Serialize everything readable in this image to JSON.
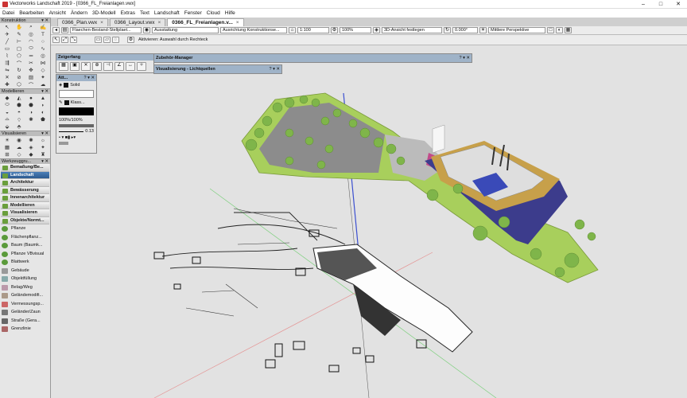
{
  "window": {
    "title": "Vectorworks Landschaft 2019 - [0366_FL_Freianlagen.vwx]",
    "controls": [
      "–",
      "□",
      "✕"
    ]
  },
  "menu": [
    "Datei",
    "Bearbeiten",
    "Ansicht",
    "Ändern",
    "3D-Modell",
    "Extras",
    "Text",
    "Landschaft",
    "Fenster",
    "Cloud",
    "Hilfe"
  ],
  "tabs": [
    {
      "label": "0366_Plan.vwx",
      "active": false
    },
    {
      "label": "0366_Layout.vwx",
      "active": false
    },
    {
      "label": "0366_FL_Freianlagen.v...",
      "active": true
    }
  ],
  "view_bar": {
    "class_select": "Flaechen-Bestand-Stellplaet...",
    "layer_select": "Ausstattung",
    "align_select": "Ausrichtung Konstruktionse...",
    "scale": "1:100",
    "zoom": "100%",
    "view_select": "3D-Ansicht festlegen",
    "rotation": "0.000°",
    "perspective_select": "Mittlere Perspektive"
  },
  "mode_bar": {
    "hint": "Aktivieren: Auswahl durch Rechteck"
  },
  "palettes": {
    "konstruktion": "Konstruktion",
    "modellieren": "Modellieren",
    "visualisieren": "Visualisieren",
    "werkzeuggruppen": "Werkzeuggru...",
    "zeigerfang": "Zeigerfang",
    "attribute": "Att...",
    "zubehoer": "Zubehör-Manager",
    "visualisierung": "Visualisierung - Lichtquellen"
  },
  "attributes": {
    "fill": "Solid",
    "pen": "Klass...",
    "opacity": "100%/100%",
    "line_weight": "0.13"
  },
  "workspace_groups": [
    {
      "label": "Bemaßung/Be...",
      "active": false
    },
    {
      "label": "Landschaft",
      "active": true
    },
    {
      "label": "Architektur",
      "active": false
    },
    {
      "label": "Bewässerung",
      "active": false
    },
    {
      "label": "Innenarchitektur",
      "active": false
    },
    {
      "label": "Modellieren",
      "active": false
    },
    {
      "label": "Visualisieren",
      "active": false
    },
    {
      "label": "Objekte/Normt...",
      "active": false
    }
  ],
  "plant_tools": [
    "Pflanze",
    "Flächenpflanz...",
    "Baum (Baumk...",
    "Pflanze VBvisual",
    "Blattwerk",
    "Gebäude",
    "Objektfüllung",
    "Belag/Weg",
    "Geländemodifi...",
    "Vermessungsp...",
    "Geländer/Zaun",
    "Straße (Gera...",
    "Grenzlinie"
  ],
  "colors": {
    "accent": "#2c5a8f",
    "canvas": "#e2e2e2",
    "grass": "#a8cf5c",
    "tree": "#7fb54a"
  }
}
